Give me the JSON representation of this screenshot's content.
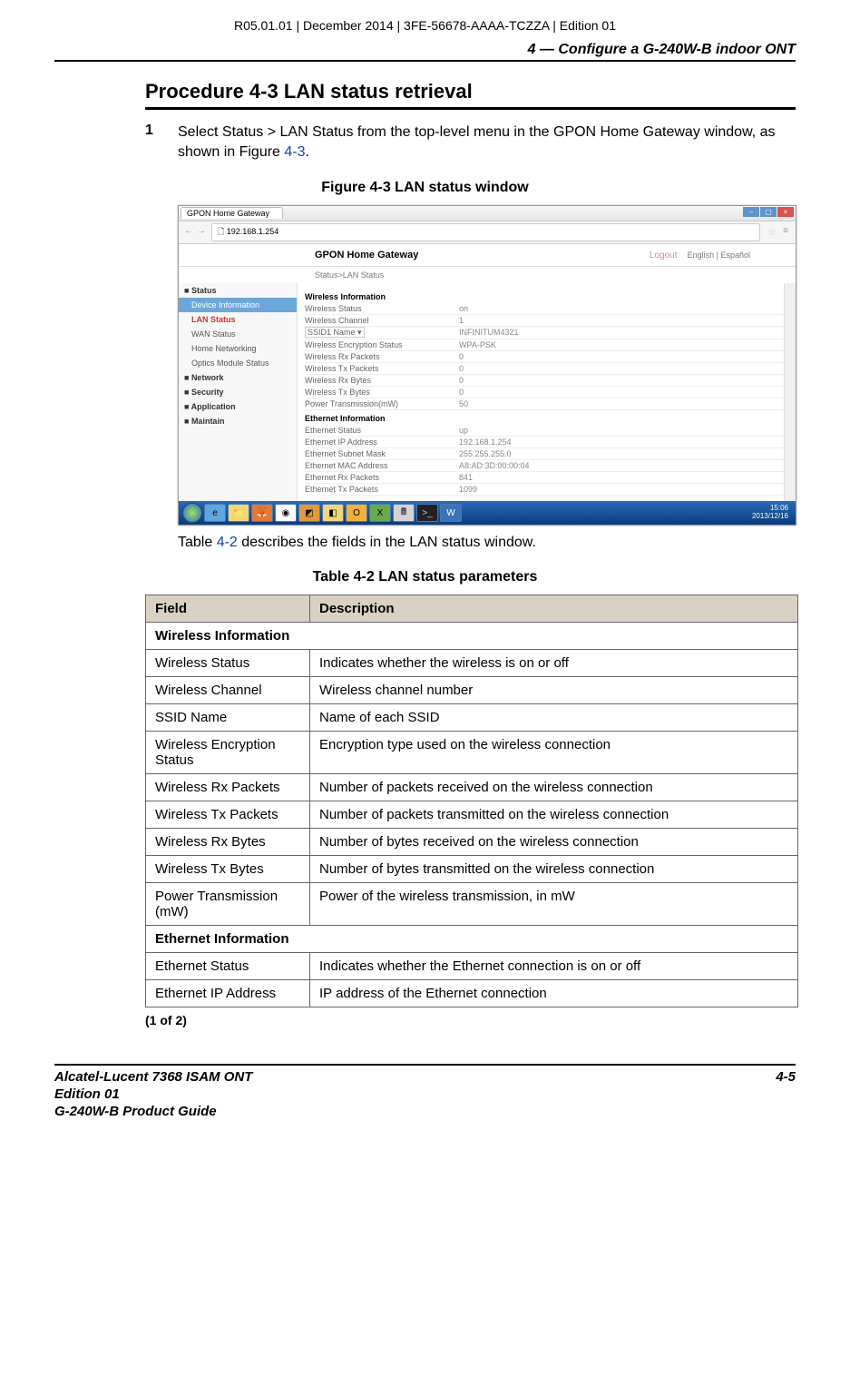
{
  "meta": {
    "topline": "R05.01.01 | December 2014 | 3FE-56678-AAAA-TCZZA | Edition 01",
    "chapter": "4 —  Configure a G-240W-B indoor ONT"
  },
  "procedure": {
    "title": "Procedure 4-3  LAN status retrieval"
  },
  "step1": {
    "num": "1",
    "text_a": "Select Status > LAN Status from the top-level menu in the GPON Home Gateway window, as shown in Figure ",
    "link": "4-3",
    "text_b": "."
  },
  "figure": {
    "caption": "Figure 4-3  LAN status window"
  },
  "screenshot": {
    "tab_title": "GPON Home Gateway",
    "url": "192.168.1.254",
    "header_title": "GPON Home Gateway",
    "logout": "Logout",
    "lang": "English | Español",
    "breadcrumb": "Status>LAN Status",
    "sidebar": {
      "status": "Status",
      "device_info": "Device Information",
      "lan_status": "LAN Status",
      "wan_status": "WAN Status",
      "home_net": "Home Networking",
      "optics": "Optics Module Status",
      "network": "Network",
      "security": "Security",
      "application": "Application",
      "maintain": "Maintain"
    },
    "wireless": {
      "section": "Wireless Information",
      "rows": [
        {
          "k": "Wireless Status",
          "v": "on"
        },
        {
          "k": "Wireless Channel",
          "v": "1"
        },
        {
          "k": "SSID1 Name",
          "v": "INFINITUM4321",
          "select": true
        },
        {
          "k": "Wireless Encryption Status",
          "v": "WPA-PSK"
        },
        {
          "k": "Wireless Rx Packets",
          "v": "0"
        },
        {
          "k": "Wireless Tx Packets",
          "v": "0"
        },
        {
          "k": "Wireless Rx Bytes",
          "v": "0"
        },
        {
          "k": "Wireless Tx Bytes",
          "v": "0"
        },
        {
          "k": "Power Transmission(mW)",
          "v": "50"
        }
      ]
    },
    "ethernet": {
      "section": "Ethernet Information",
      "rows": [
        {
          "k": "Ethernet Status",
          "v": "up"
        },
        {
          "k": "Ethernet IP Address",
          "v": "192.168.1.254"
        },
        {
          "k": "Ethernet Subnet Mask",
          "v": "255.255.255.0"
        },
        {
          "k": "Ethernet MAC Address",
          "v": "A8:AD:3D:00:00:04"
        },
        {
          "k": "Ethernet Rx Packets",
          "v": "841"
        },
        {
          "k": "Ethernet Tx Packets",
          "v": "1099"
        }
      ]
    },
    "clock_time": "15:06",
    "clock_date": "2013/12/16"
  },
  "after_fig": {
    "text_a": "Table ",
    "link": "4-2",
    "text_b": " describes the fields in the LAN status window."
  },
  "table": {
    "caption": "Table 4-2 LAN status parameters",
    "header_field": "Field",
    "header_desc": "Description",
    "section_wireless": "Wireless Information",
    "section_ethernet": "Ethernet Information",
    "rows_wireless": [
      {
        "f": "Wireless Status",
        "d": "Indicates whether the wireless is on or off"
      },
      {
        "f": "Wireless Channel",
        "d": "Wireless channel number"
      },
      {
        "f": "SSID Name",
        "d": "Name of each SSID"
      },
      {
        "f": "Wireless Encryption Status",
        "d": "Encryption type used on the wireless connection"
      },
      {
        "f": "Wireless Rx Packets",
        "d": "Number of packets received on the wireless connection"
      },
      {
        "f": "Wireless Tx Packets",
        "d": "Number of packets transmitted on the wireless connection"
      },
      {
        "f": "Wireless Rx Bytes",
        "d": "Number of bytes received on the wireless connection"
      },
      {
        "f": "Wireless Tx Bytes",
        "d": "Number of bytes transmitted on the wireless connection"
      },
      {
        "f": "Power Transmission (mW)",
        "d": "Power of the wireless transmission, in mW"
      }
    ],
    "rows_ethernet": [
      {
        "f": "Ethernet Status",
        "d": "Indicates whether the Ethernet connection is on or off"
      },
      {
        "f": "Ethernet IP Address",
        "d": "IP address of the Ethernet connection"
      }
    ],
    "pager": "(1 of 2)"
  },
  "footer": {
    "left1": "Alcatel-Lucent 7368 ISAM ONT",
    "left2": "Edition 01",
    "left3": "G-240W-B Product Guide",
    "right": "4-5"
  }
}
